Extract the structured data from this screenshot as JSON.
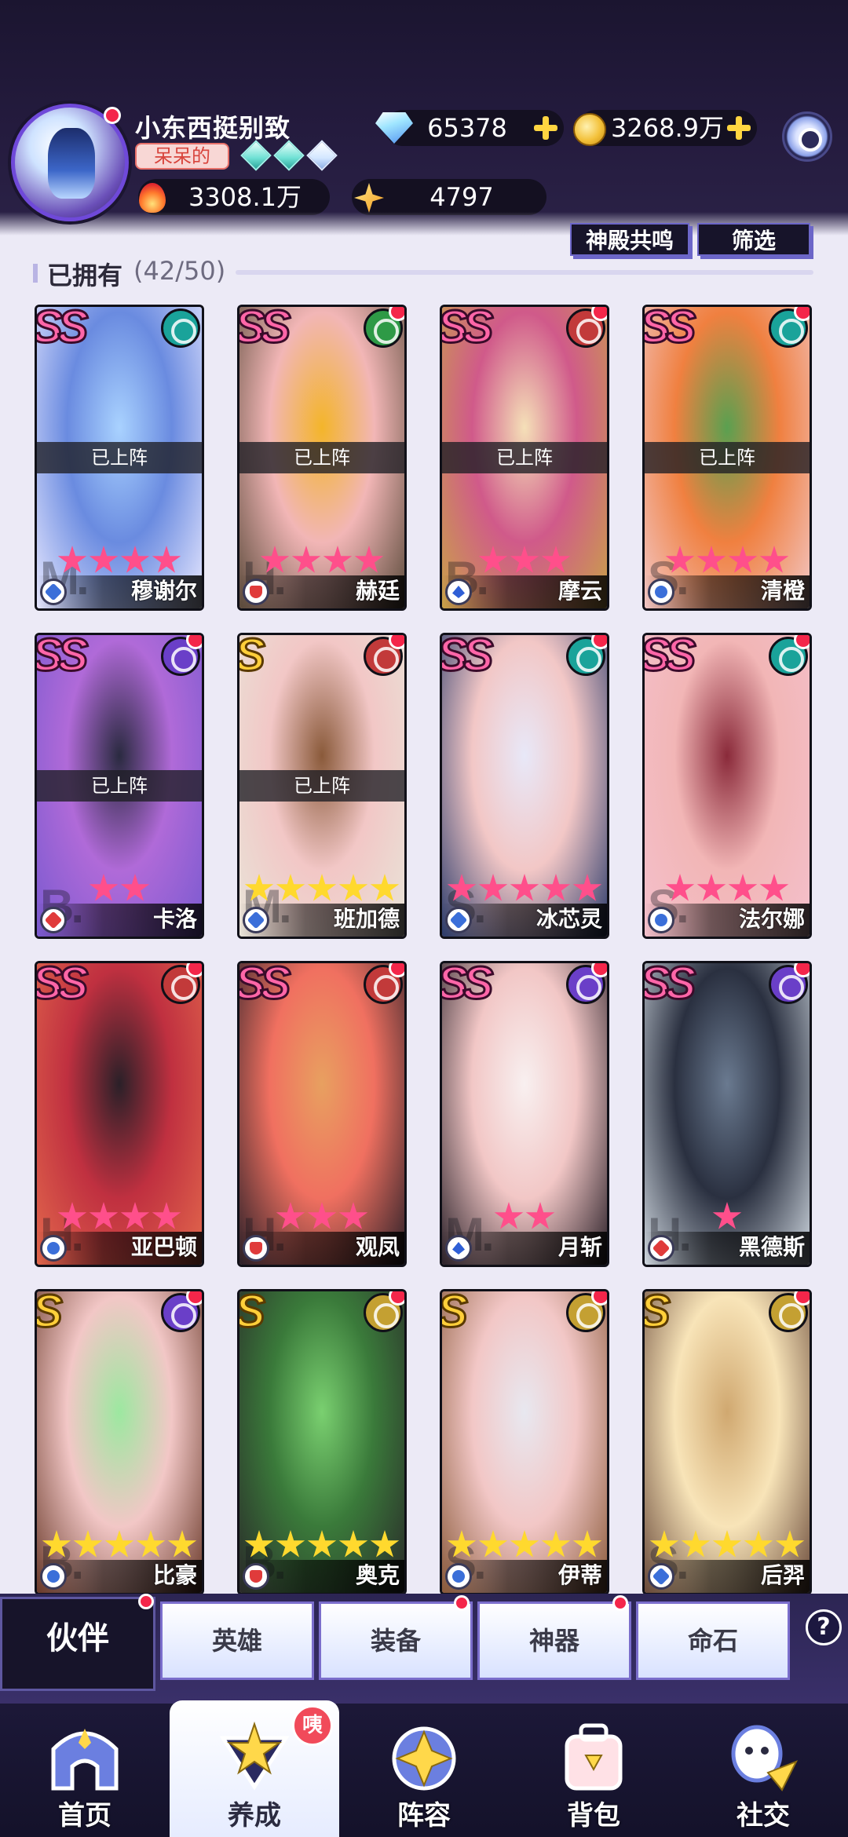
{
  "player": {
    "name": "小东西挺别致",
    "title_tag": "呆呆的",
    "diamonds": "65378",
    "gold": "3268.9万",
    "power": "3308.1万",
    "stars": "4797"
  },
  "actions": {
    "temple_resonance": "神殿共鸣",
    "filter": "筛选"
  },
  "section": {
    "title": "已拥有",
    "count": "(42/50)"
  },
  "cards": [
    {
      "name": "穆谢尔",
      "rank": "SS",
      "stars": 4,
      "star_color": "pink",
      "deployed": "已上阵",
      "role": "assassin",
      "element": "wind",
      "red_dot": false,
      "art": [
        "#6a8be0",
        "#a9d2ff",
        "#e8e8ff"
      ],
      "letter": "M."
    },
    {
      "name": "赫廷",
      "rank": "SS",
      "stars": 4,
      "star_color": "pink",
      "deployed": "已上阵",
      "role": "tank",
      "element": "nature",
      "red_dot": true,
      "art": [
        "#f2b6b6",
        "#f3b52a",
        "#5a4a3a"
      ],
      "letter": "H."
    },
    {
      "name": "摩云",
      "rank": "SS",
      "stars": 3,
      "star_color": "pink",
      "deployed": "已上阵",
      "role": "mage",
      "element": "fire",
      "red_dot": true,
      "art": [
        "#d05a8a",
        "#f5e0b8",
        "#c9a248"
      ],
      "letter": "B."
    },
    {
      "name": "清橙",
      "rank": "SS",
      "stars": 4,
      "star_color": "pink",
      "deployed": "已上阵",
      "role": "support",
      "element": "wind",
      "red_dot": true,
      "art": [
        "#f08040",
        "#5aa050",
        "#f2c7c6"
      ],
      "letter": "S."
    },
    {
      "name": "卡洛",
      "rank": "SS",
      "stars": 2,
      "star_color": "pink",
      "deployed": "已上阵",
      "role": "warrior",
      "element": "dark",
      "red_dot": true,
      "art": [
        "#b06ad8",
        "#2a2a40",
        "#7a5ad0"
      ],
      "letter": "B."
    },
    {
      "name": "班加德",
      "rank": "S",
      "stars": 5,
      "star_color": "gold",
      "deployed": "已上阵",
      "role": "assassin",
      "element": "fire",
      "red_dot": true,
      "art": [
        "#f2c7c6",
        "#8a5a3a",
        "#e8e4d8"
      ],
      "letter": "M."
    },
    {
      "name": "冰芯灵",
      "rank": "SS",
      "stars": 5,
      "star_color": "pink",
      "deployed": "",
      "role": "assassin",
      "element": "wind",
      "red_dot": true,
      "art": [
        "#f2c7c6",
        "#e8e8f8",
        "#2a3a6a"
      ],
      "letter": "S."
    },
    {
      "name": "法尔娜",
      "rank": "SS",
      "stars": 4,
      "star_color": "pink",
      "deployed": "",
      "role": "support",
      "element": "wind",
      "red_dot": true,
      "art": [
        "#f2b6b6",
        "#8a2a3a",
        "#f4c0cc"
      ],
      "letter": "S."
    },
    {
      "name": "亚巴顿",
      "rank": "SS",
      "stars": 4,
      "star_color": "pink",
      "deployed": "",
      "role": "support",
      "element": "fire",
      "red_dot": true,
      "art": [
        "#c03040",
        "#2a2028",
        "#e2684c"
      ],
      "letter": "H."
    },
    {
      "name": "观凤",
      "rank": "SS",
      "stars": 3,
      "star_color": "pink",
      "deployed": "",
      "role": "tank",
      "element": "fire",
      "red_dot": true,
      "art": [
        "#f07060",
        "#e8a060",
        "#2a2028"
      ],
      "letter": "H."
    },
    {
      "name": "月斩",
      "rank": "SS",
      "stars": 2,
      "star_color": "pink",
      "deployed": "",
      "role": "mage",
      "element": "dark",
      "red_dot": true,
      "art": [
        "#f2c7c6",
        "#f8f0f0",
        "#2a2028"
      ],
      "letter": "M."
    },
    {
      "name": "黑德斯",
      "rank": "SS",
      "stars": 1,
      "star_color": "pink",
      "deployed": "",
      "role": "warrior",
      "element": "dark",
      "red_dot": true,
      "art": [
        "#2a3040",
        "#6a7a90",
        "#d0d8e0"
      ],
      "letter": "H."
    },
    {
      "name": "比豪",
      "rank": "S",
      "stars": 5,
      "star_color": "gold",
      "deployed": "",
      "role": "support",
      "element": "dark",
      "red_dot": true,
      "art": [
        "#f2c7c6",
        "#9ce8a0",
        "#6a3a2a"
      ],
      "letter": "B."
    },
    {
      "name": "奥克",
      "rank": "S",
      "stars": 5,
      "star_color": "gold",
      "deployed": "",
      "role": "tank",
      "element": "light",
      "red_dot": true,
      "art": [
        "#3a7a3a",
        "#7ad070",
        "#2a2a2a"
      ],
      "letter": "B."
    },
    {
      "name": "伊蒂",
      "rank": "S",
      "stars": 5,
      "star_color": "gold",
      "deployed": "",
      "role": "support",
      "element": "light",
      "red_dot": true,
      "art": [
        "#f2c7c6",
        "#e8e8f0",
        "#8a5a3a"
      ],
      "letter": "S."
    },
    {
      "name": "后羿",
      "rank": "S",
      "stars": 5,
      "star_color": "gold",
      "deployed": "",
      "role": "assassin",
      "element": "light",
      "red_dot": true,
      "art": [
        "#f8e4b8",
        "#d0a870",
        "#6a4a3a"
      ],
      "letter": "S."
    }
  ],
  "tabs": [
    {
      "label": "伙伴",
      "active": true,
      "red_dot": true
    },
    {
      "label": "英雄",
      "active": false,
      "red_dot": false
    },
    {
      "label": "装备",
      "active": false,
      "red_dot": true
    },
    {
      "label": "神器",
      "active": false,
      "red_dot": true
    },
    {
      "label": "命石",
      "active": false,
      "red_dot": false
    }
  ],
  "help_label": "?",
  "nav": [
    {
      "label": "首页",
      "icon": "home-icon",
      "active": false
    },
    {
      "label": "养成",
      "icon": "cultivate-icon",
      "active": true,
      "badge": "咦"
    },
    {
      "label": "阵容",
      "icon": "lineup-icon",
      "active": false
    },
    {
      "label": "背包",
      "icon": "backpack-icon",
      "active": false
    },
    {
      "label": "社交",
      "icon": "social-icon",
      "active": false
    }
  ],
  "colors": {
    "accent": "#6f49d9",
    "red_dot": "#f4264a",
    "pink_star": "#ff4f8b",
    "gold_star": "#ffd92e",
    "element_wind": "#1aa39a",
    "element_fire": "#c23a3a",
    "element_nature": "#2e9a46",
    "element_dark": "#6a3fc8",
    "element_light": "#c4a032"
  }
}
